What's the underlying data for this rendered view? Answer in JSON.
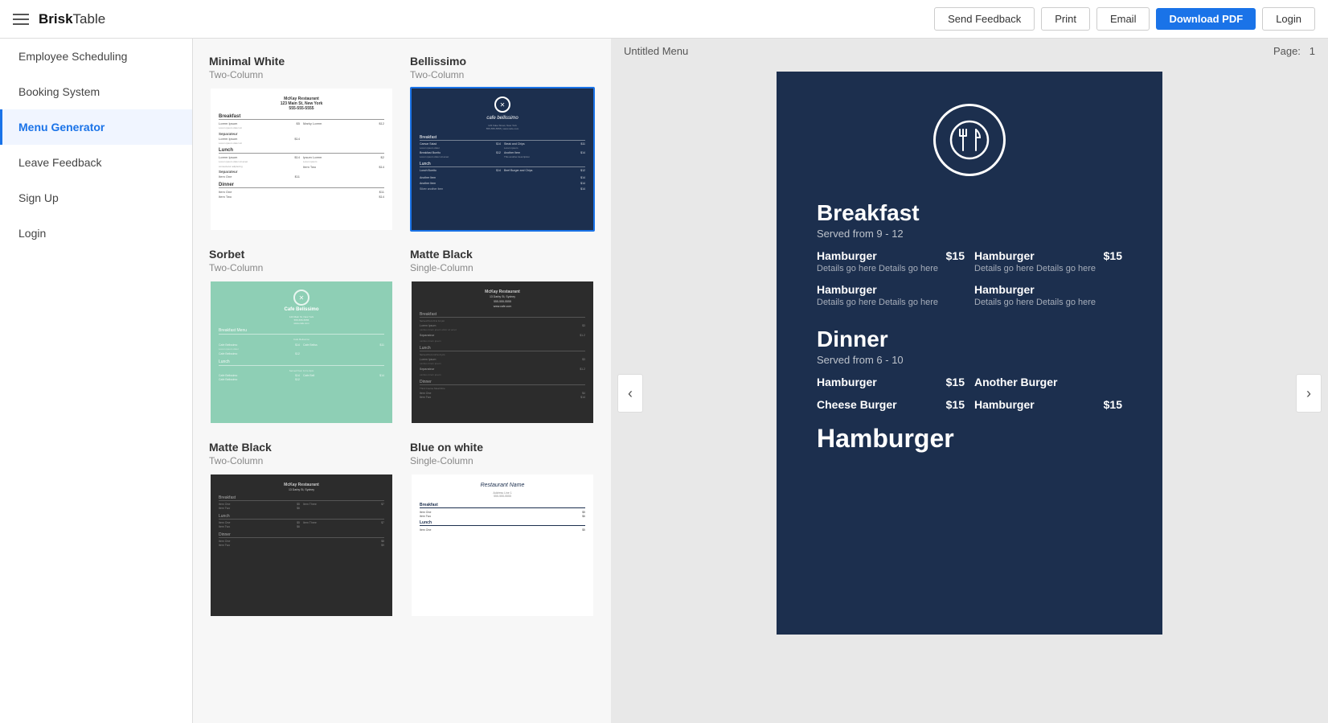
{
  "app": {
    "brand": "Brisk",
    "brand_suffix": "Table",
    "hamburger_label": "menu"
  },
  "topbar": {
    "send_feedback": "Send Feedback",
    "print": "Print",
    "email": "Email",
    "download_pdf": "Download PDF",
    "login": "Login"
  },
  "sidebar": {
    "items": [
      {
        "id": "employee-scheduling",
        "label": "Employee Scheduling",
        "active": false
      },
      {
        "id": "booking-system",
        "label": "Booking System",
        "active": false
      },
      {
        "id": "menu-generator",
        "label": "Menu Generator",
        "active": true
      },
      {
        "id": "leave-feedback",
        "label": "Leave Feedback",
        "active": false
      },
      {
        "id": "sign-up",
        "label": "Sign Up",
        "active": false
      },
      {
        "id": "login",
        "label": "Login",
        "active": false
      }
    ]
  },
  "templates": [
    {
      "id": "minimal-white",
      "title": "Minimal White",
      "subtitle": "Two-Column",
      "style": "minimal-white",
      "selected": false
    },
    {
      "id": "bellissimo",
      "title": "Bellissimo",
      "subtitle": "Two-Column",
      "style": "bellissimo",
      "selected": true
    },
    {
      "id": "sorbet",
      "title": "Sorbet",
      "subtitle": "Two-Column",
      "style": "sorbet",
      "selected": false
    },
    {
      "id": "matte-black-single",
      "title": "Matte Black",
      "subtitle": "Single-Column",
      "style": "matte-black",
      "selected": false
    },
    {
      "id": "matte-black-two",
      "title": "Matte Black",
      "subtitle": "Two-Column",
      "style": "matte-black-2",
      "selected": false
    },
    {
      "id": "blue-on-white",
      "title": "Blue on white",
      "subtitle": "Single-Column",
      "style": "blue-white",
      "selected": false
    }
  ],
  "preview": {
    "menu_title": "Untitled Menu",
    "page_label": "Page:",
    "page_number": "1",
    "nav_left": "‹",
    "nav_right": "›"
  },
  "menu": {
    "logo_icon": "✕",
    "sections": [
      {
        "title": "Breakfast",
        "subtitle": "Served from 9 - 12",
        "layout": "two-column",
        "items": [
          {
            "name": "Hamburger",
            "price": "$15",
            "desc": "Details go here Details go here"
          },
          {
            "name": "Hamburger",
            "price": "$15",
            "desc": "Details go here Details go here"
          },
          {
            "name": "Hamburger",
            "price": null,
            "desc": "Details go here Details go here"
          },
          {
            "name": "Hamburger",
            "price": null,
            "desc": "Details go here Details go here"
          }
        ]
      },
      {
        "title": "Dinner",
        "subtitle": "Served from 6 - 10",
        "layout": "mixed",
        "items": [
          {
            "name": "Hamburger",
            "price": "$15",
            "col": "left"
          },
          {
            "name": "Another Burger",
            "price": null,
            "col": "right"
          },
          {
            "name": "Cheese Burger",
            "price": "$15",
            "col": "left"
          },
          {
            "name": "Hamburger",
            "price": "$15",
            "col": "right"
          }
        ]
      },
      {
        "title": "Hamburger",
        "subtitle": null,
        "layout": "heading-only",
        "items": []
      }
    ]
  }
}
